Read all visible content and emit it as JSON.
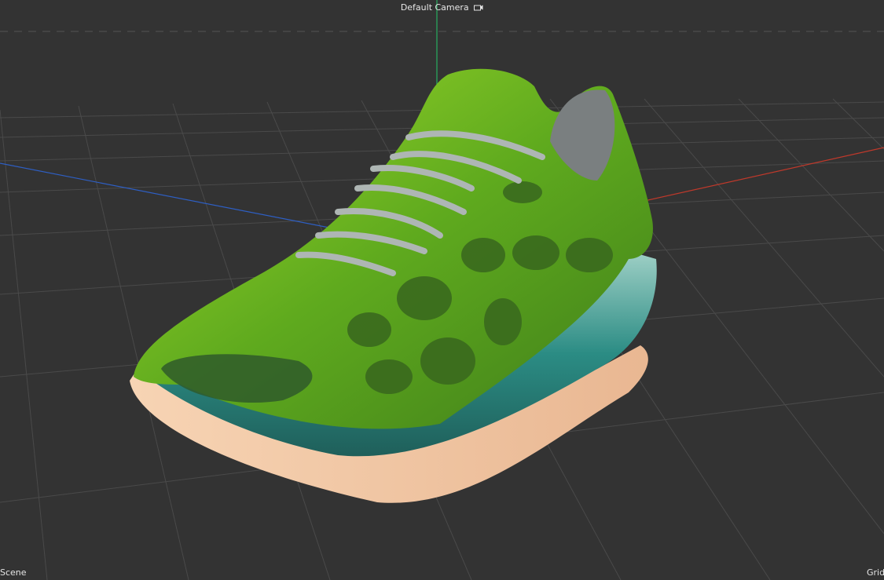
{
  "viewport": {
    "camera_label": "Default Camera",
    "scene_label": "Scene",
    "grid_label": "Grid",
    "camera_icon": "camera-icon"
  },
  "colors": {
    "background": "#333333",
    "grid_line": "#4a4a4a",
    "axis_x": "#c0392b",
    "axis_y": "#27ae60",
    "axis_z": "#2e5fc4",
    "model_upper": "#6fbf1f",
    "model_sole": "#2a8f86",
    "model_outsole": "#f2c9a8"
  }
}
